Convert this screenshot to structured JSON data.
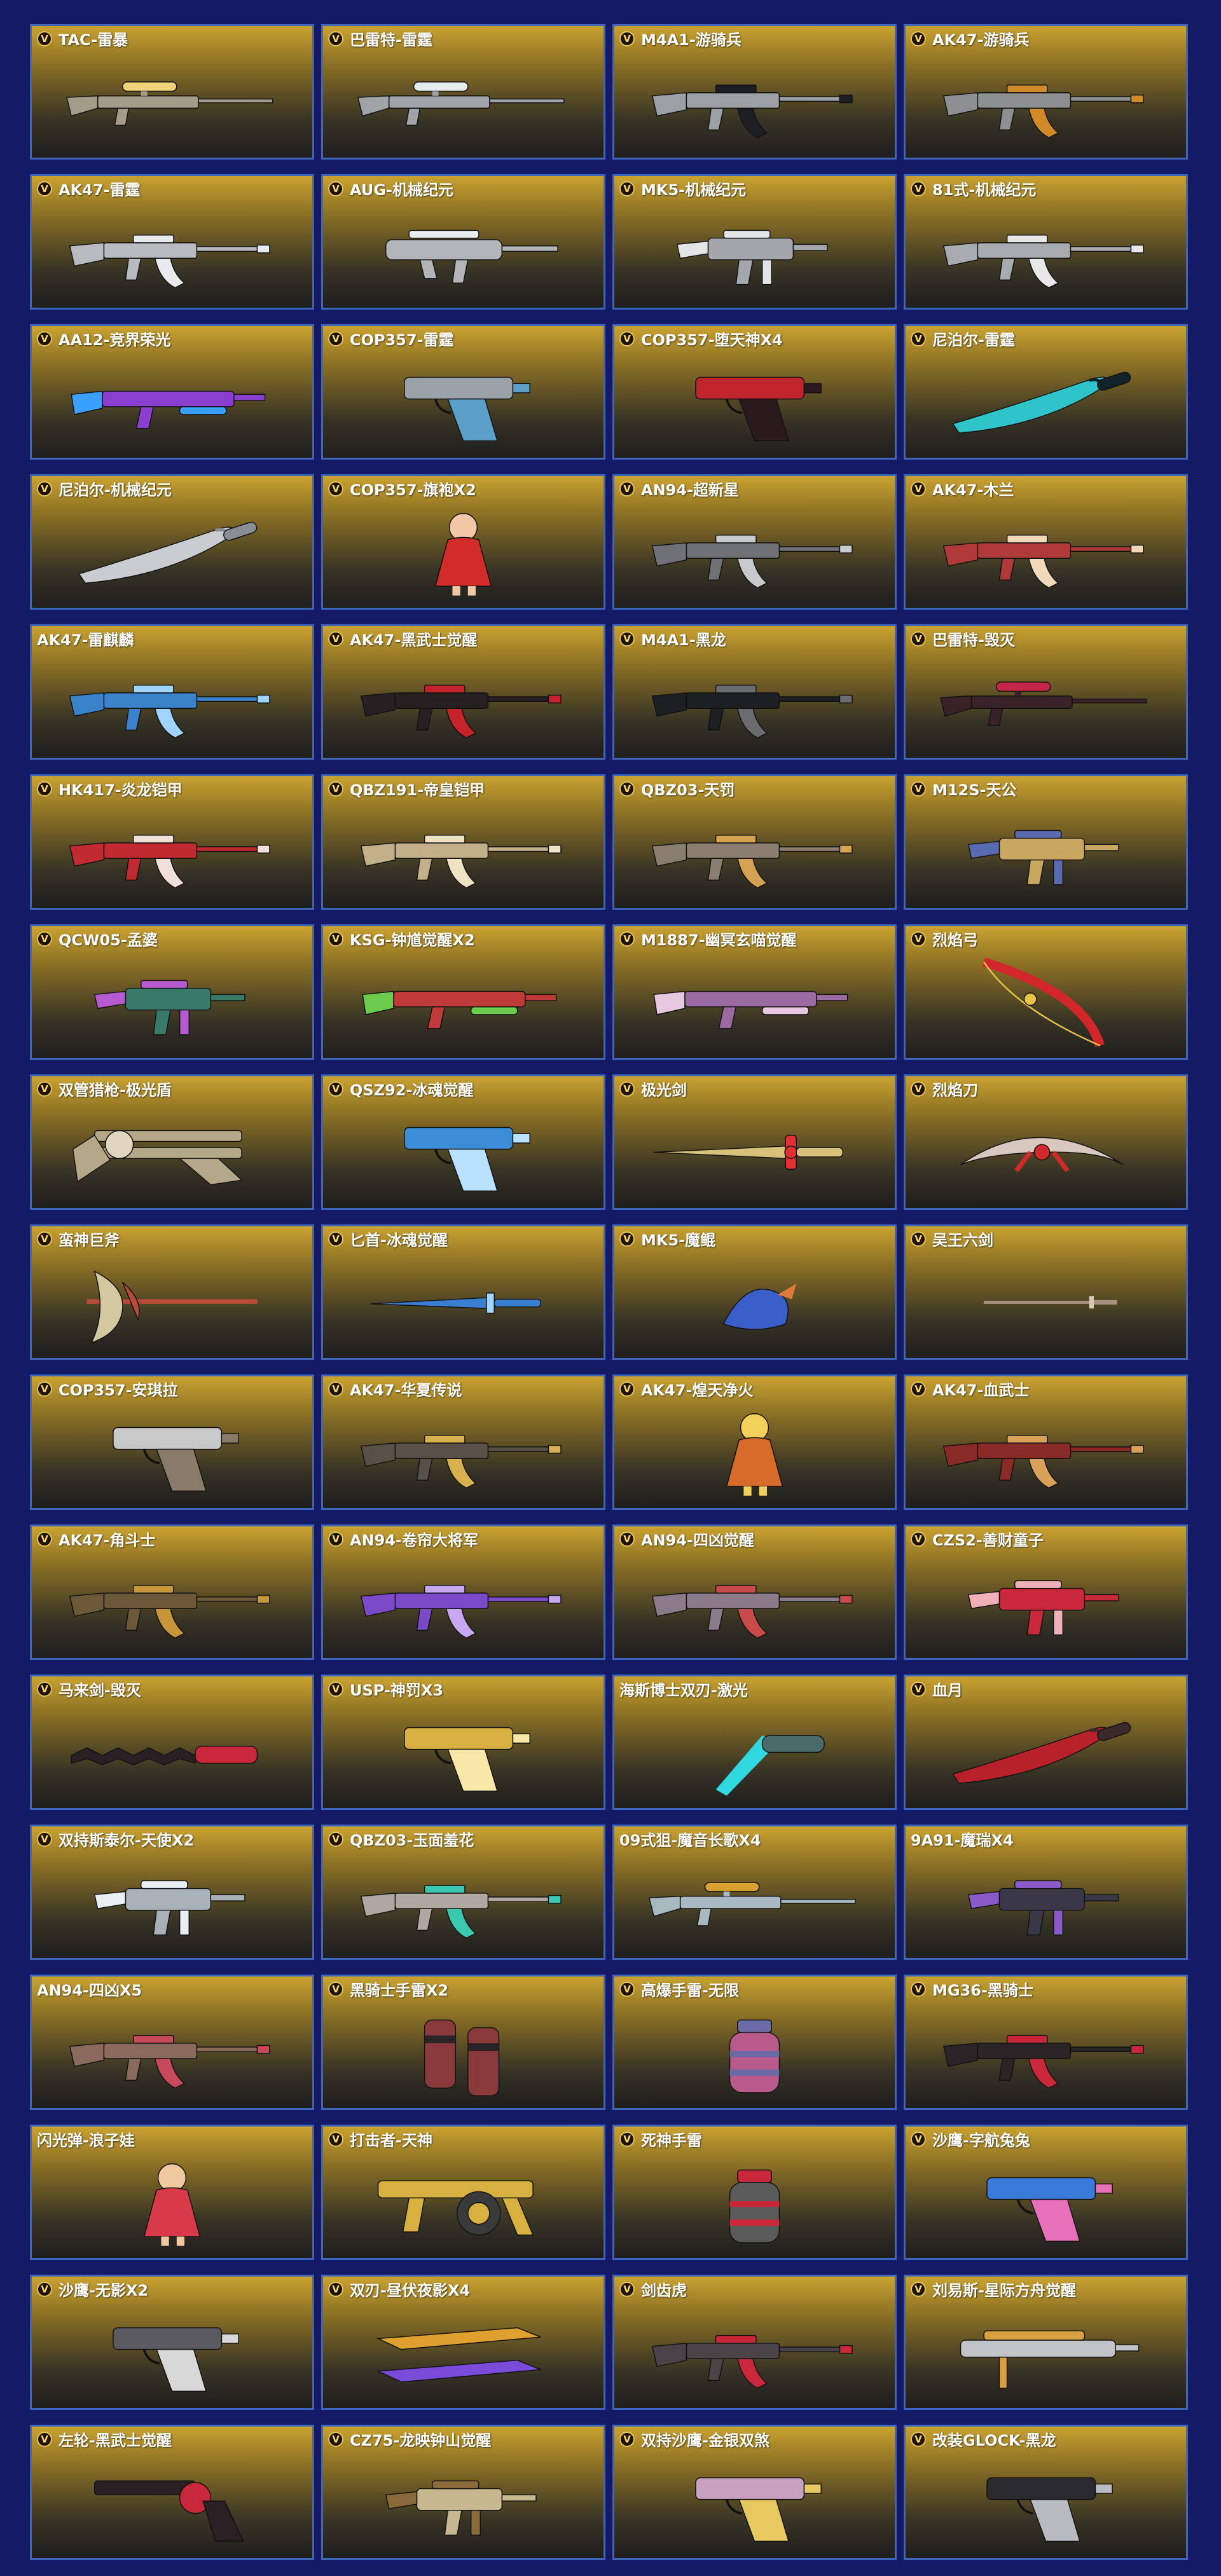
{
  "badge_glyph": "V",
  "colors": {
    "background": "#151a66",
    "card_border": "#3d66bd",
    "card_gradient_top": "#caa230",
    "card_gradient_bottom": "#222020",
    "badge_ring": "#e7c25a",
    "title_text": "#ffffff"
  },
  "items": [
    {
      "name": "TAC-雷暴",
      "badge": true,
      "icon": "sniper-rifle-icon",
      "color": "#a49b88",
      "accent": "#f0d37a"
    },
    {
      "name": "巴雷特-雷霆",
      "badge": true,
      "icon": "sniper-rifle-icon",
      "color": "#9ea4a8",
      "accent": "#e7ecef"
    },
    {
      "name": "M4A1-游骑兵",
      "badge": true,
      "icon": "assault-rifle-icon",
      "color": "#9aa0a4",
      "accent": "#1e1f22"
    },
    {
      "name": "AK47-游骑兵",
      "badge": true,
      "icon": "assault-rifle-icon",
      "color": "#8d8f90",
      "accent": "#d08a2a"
    },
    {
      "name": "AK47-雷霆",
      "badge": true,
      "icon": "assault-rifle-icon",
      "color": "#b8bcc0",
      "accent": "#e8eaed"
    },
    {
      "name": "AUG-机械纪元",
      "badge": true,
      "icon": "bullpup-rifle-icon",
      "color": "#b3b6b9",
      "accent": "#e9ecee"
    },
    {
      "name": "MK5-机械纪元",
      "badge": true,
      "icon": "smg-icon",
      "color": "#a3a7ab",
      "accent": "#e2e4e6"
    },
    {
      "name": "81式-机械纪元",
      "badge": true,
      "icon": "assault-rifle-icon",
      "color": "#a8acaf",
      "accent": "#e8e8e8"
    },
    {
      "name": "AA12-竞界荣光",
      "badge": true,
      "icon": "shotgun-icon",
      "color": "#8a3fd0",
      "accent": "#3aa0ff"
    },
    {
      "name": "COP357-雷霆",
      "badge": true,
      "icon": "pistol-icon",
      "color": "#9aa2a8",
      "accent": "#5aa0c8"
    },
    {
      "name": "COP357-堕天神X4",
      "badge": true,
      "icon": "pistol-icon",
      "color": "#c0252d",
      "accent": "#2a1a1e"
    },
    {
      "name": "尼泊尔-雷霆",
      "badge": true,
      "icon": "machete-icon",
      "color": "#2ec4c9",
      "accent": "#11222a"
    },
    {
      "name": "尼泊尔-机械纪元",
      "badge": true,
      "icon": "machete-icon",
      "color": "#c9ccd0",
      "accent": "#8a8e94"
    },
    {
      "name": "COP357-旗袍X2",
      "badge": true,
      "icon": "character-icon",
      "color": "#d32a2a",
      "accent": "#f1c7a5"
    },
    {
      "name": "AN94-超新星",
      "badge": true,
      "icon": "assault-rifle-icon",
      "color": "#6f7176",
      "accent": "#c8cacd"
    },
    {
      "name": "AK47-木兰",
      "badge": true,
      "icon": "assault-rifle-icon",
      "color": "#b03a3a",
      "accent": "#f0d8b8"
    },
    {
      "name": "AK47-雷麒麟",
      "badge": false,
      "icon": "assault-rifle-icon",
      "color": "#3a82c9",
      "accent": "#9fd4ff"
    },
    {
      "name": "AK47-黑武士觉醒",
      "badge": true,
      "icon": "assault-rifle-icon",
      "color": "#272022",
      "accent": "#c6222c"
    },
    {
      "name": "M4A1-黑龙",
      "badge": true,
      "icon": "assault-rifle-icon",
      "color": "#1e1f22",
      "accent": "#6a6c70"
    },
    {
      "name": "巴雷特-毁灭",
      "badge": true,
      "icon": "sniper-rifle-icon",
      "color": "#3a2328",
      "accent": "#c4274a"
    },
    {
      "name": "HK417-炎龙铠甲",
      "badge": true,
      "icon": "assault-rifle-icon",
      "color": "#c02a30",
      "accent": "#f0e0d8"
    },
    {
      "name": "QBZ191-帝皇铠甲",
      "badge": true,
      "icon": "assault-rifle-icon",
      "color": "#c2b08a",
      "accent": "#efe3c4"
    },
    {
      "name": "QBZ03-天罚",
      "badge": true,
      "icon": "assault-rifle-icon",
      "color": "#8a7e70",
      "accent": "#d4a250"
    },
    {
      "name": "M12S-天公",
      "badge": true,
      "icon": "smg-icon",
      "color": "#c8a860",
      "accent": "#5a6ab0"
    },
    {
      "name": "QCW05-孟婆",
      "badge": true,
      "icon": "smg-icon",
      "color": "#3a7a6a",
      "accent": "#b65acf"
    },
    {
      "name": "KSG-钟馗觉醒X2",
      "badge": true,
      "icon": "shotgun-icon",
      "color": "#c03a3a",
      "accent": "#6acc4a"
    },
    {
      "name": "M1887-幽冥玄喵觉醒",
      "badge": true,
      "icon": "shotgun-icon",
      "color": "#9a6aa0",
      "accent": "#e8c8e0"
    },
    {
      "name": "烈焰弓",
      "badge": true,
      "icon": "bow-icon",
      "color": "#d2262a",
      "accent": "#e8c34a"
    },
    {
      "name": "双管猎枪-极光盾",
      "badge": true,
      "icon": "double-barrel-icon",
      "color": "#b5a888",
      "accent": "#e0d6be"
    },
    {
      "name": "QSZ92-冰魂觉醒",
      "badge": true,
      "icon": "pistol-icon",
      "color": "#3a8ed8",
      "accent": "#b8e2ff"
    },
    {
      "name": "极光剑",
      "badge": true,
      "icon": "sword-icon",
      "color": "#d8c27a",
      "accent": "#e03030"
    },
    {
      "name": "烈焰刀",
      "badge": true,
      "icon": "crescent-blade-icon",
      "color": "#d8c8c0",
      "accent": "#d02a2a"
    },
    {
      "name": "蛮神巨斧",
      "badge": true,
      "icon": "axe-icon",
      "color": "#d4c8a0",
      "accent": "#b84a3a"
    },
    {
      "name": "匕首-冰魂觉醒",
      "badge": true,
      "icon": "dagger-icon",
      "color": "#3a7ed0",
      "accent": "#9fd6ff"
    },
    {
      "name": "MK5-魔鲲",
      "badge": true,
      "icon": "creature-icon",
      "color": "#3a5ec8",
      "accent": "#e07a3a"
    },
    {
      "name": "吴王六剑",
      "badge": true,
      "icon": "thin-sword-icon",
      "color": "#a89080",
      "accent": "#d8c8b8"
    },
    {
      "name": "COP357-安琪拉",
      "badge": true,
      "icon": "pistol-icon",
      "color": "#c8c8c8",
      "accent": "#8a7a6a"
    },
    {
      "name": "AK47-华夏传说",
      "badge": true,
      "icon": "assault-rifle-icon",
      "color": "#5a5048",
      "accent": "#d8b050"
    },
    {
      "name": "AK47-煌天净火",
      "badge": true,
      "icon": "character-icon",
      "color": "#d86a2a",
      "accent": "#f2d05a"
    },
    {
      "name": "AK47-血武士",
      "badge": true,
      "icon": "assault-rifle-icon",
      "color": "#8a2a26",
      "accent": "#d8a058"
    },
    {
      "name": "AK47-角斗士",
      "badge": true,
      "icon": "assault-rifle-icon",
      "color": "#6a5838",
      "accent": "#c8963a"
    },
    {
      "name": "AN94-卷帘大将军",
      "badge": true,
      "icon": "assault-rifle-icon",
      "color": "#7a4ac8",
      "accent": "#c8a8f0"
    },
    {
      "name": "AN94-四凶觉醒",
      "badge": true,
      "icon": "assault-rifle-icon",
      "color": "#8a7a8a",
      "accent": "#c84a4a"
    },
    {
      "name": "CZS2-善财童子",
      "badge": true,
      "icon": "smg-icon",
      "color": "#c8283a",
      "accent": "#f0b0b8"
    },
    {
      "name": "马来剑-毁灭",
      "badge": true,
      "icon": "kris-icon",
      "color": "#282024",
      "accent": "#c8283a"
    },
    {
      "name": "USP-神罚X3",
      "badge": true,
      "icon": "pistol-icon",
      "color": "#d8b040",
      "accent": "#f8e8a8"
    },
    {
      "name": "海斯博士双刃-激光",
      "badge": false,
      "icon": "laser-blade-icon",
      "color": "#30d8e0",
      "accent": "#4a6a6a"
    },
    {
      "name": "血月",
      "badge": true,
      "icon": "machete-icon",
      "color": "#b8202a",
      "accent": "#3a2a2a"
    },
    {
      "name": "双持斯泰尔-天使X2",
      "badge": true,
      "icon": "smg-icon",
      "color": "#a8b0b8",
      "accent": "#e8eef2"
    },
    {
      "name": "QBZ03-玉面羞花",
      "badge": true,
      "icon": "assault-rifle-icon",
      "color": "#b0a8a0",
      "accent": "#3ac8b0"
    },
    {
      "name": "09式狙-魔音长歌X4",
      "badge": false,
      "icon": "sniper-rifle-icon",
      "color": "#a8b8c0",
      "accent": "#d8a030"
    },
    {
      "name": "9A91-魔瑞X4",
      "badge": false,
      "icon": "smg-icon",
      "color": "#3a3848",
      "accent": "#8a5ac8"
    },
    {
      "name": "AN94-四凶X5",
      "badge": false,
      "icon": "assault-rifle-icon",
      "color": "#8a6a5a",
      "accent": "#c84a5a"
    },
    {
      "name": "黑骑士手雷X2",
      "badge": true,
      "icon": "grenade-pair-icon",
      "color": "#8a3a3a",
      "accent": "#2a2226"
    },
    {
      "name": "高爆手雷-无限",
      "badge": true,
      "icon": "grenade-icon",
      "color": "#b85a8a",
      "accent": "#6a6aa8"
    },
    {
      "name": "MG36-黑骑士",
      "badge": true,
      "icon": "assault-rifle-icon",
      "color": "#2a2426",
      "accent": "#c8283a"
    },
    {
      "name": "闪光弹-浪子娃",
      "badge": false,
      "icon": "character-icon",
      "color": "#d83a4a",
      "accent": "#f0c8a0"
    },
    {
      "name": "打击者-天神",
      "badge": true,
      "icon": "drum-shotgun-icon",
      "color": "#d8b040",
      "accent": "#3a3a3a"
    },
    {
      "name": "死神手雷",
      "badge": true,
      "icon": "grenade-icon",
      "color": "#5a5a5a",
      "accent": "#c8283a"
    },
    {
      "name": "沙鹰-字航兔兔",
      "badge": true,
      "icon": "pistol-icon",
      "color": "#3a7ad8",
      "accent": "#e870b8"
    },
    {
      "name": "沙鹰-无影X2",
      "badge": true,
      "icon": "pistol-icon",
      "color": "#5a5a60",
      "accent": "#d8d8d8"
    },
    {
      "name": "双刃-昼伏夜影X4",
      "badge": true,
      "icon": "dual-blade-icon",
      "color": "#e0a030",
      "accent": "#7a4ad8"
    },
    {
      "name": "剑齿虎",
      "badge": true,
      "icon": "assault-rifle-icon",
      "color": "#4a4448",
      "accent": "#c8283a"
    },
    {
      "name": "刘易斯-星际方舟觉醒",
      "badge": true,
      "icon": "lmg-icon",
      "color": "#c0c4c8",
      "accent": "#d8a040"
    },
    {
      "name": "左轮-黑武士觉醒",
      "badge": true,
      "icon": "revolver-icon",
      "color": "#2a2024",
      "accent": "#c8283a"
    },
    {
      "name": "CZ75-龙映钟山觉醒",
      "badge": true,
      "icon": "smg-icon",
      "color": "#c8b890",
      "accent": "#8a6a3a"
    },
    {
      "name": "双持沙鹰-金银双煞",
      "badge": true,
      "icon": "pistol-icon",
      "color": "#c8a0c0",
      "accent": "#e8c860"
    },
    {
      "name": "改装GLOCK-黑龙",
      "badge": true,
      "icon": "pistol-icon",
      "color": "#2a2a2e",
      "accent": "#b8bcc0"
    }
  ]
}
